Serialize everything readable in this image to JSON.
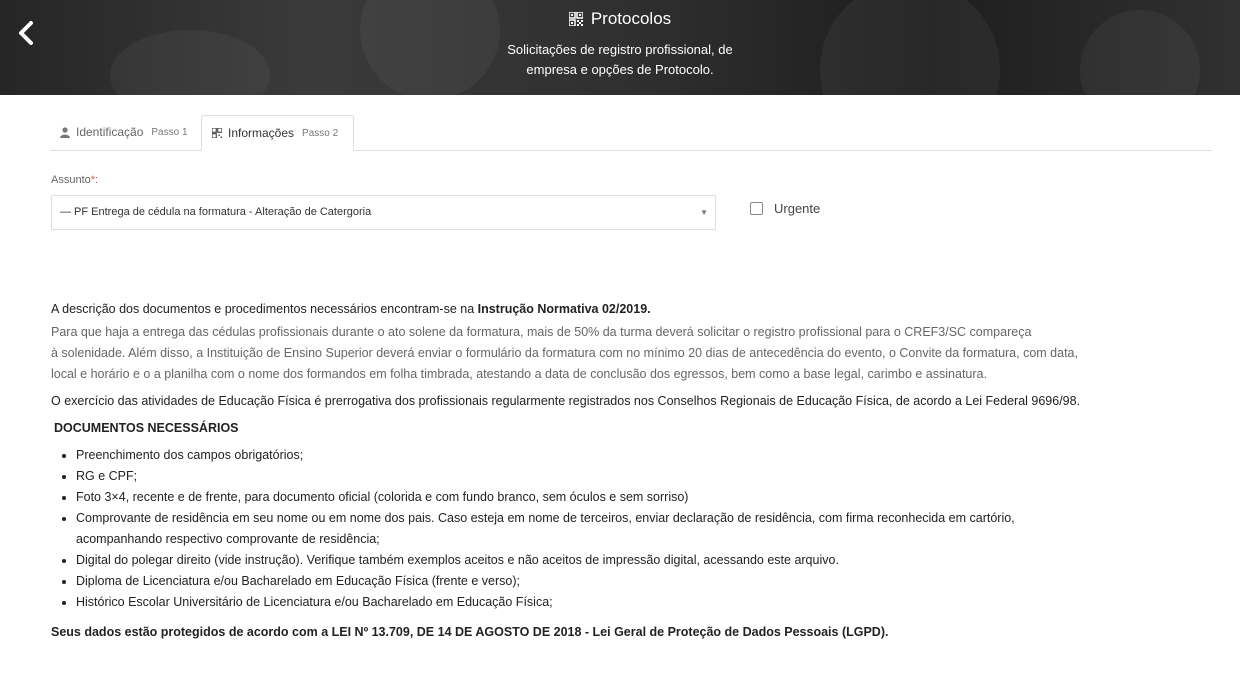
{
  "header": {
    "title": "Protocolos",
    "subtitle_line1": "Solicitações de registro profissional, de",
    "subtitle_line2": "empresa e opções de Protocolo.",
    "back_icon": "chevron-left-icon",
    "title_icon": "qrcode-icon"
  },
  "tabs": [
    {
      "label": "Identificação",
      "step": "Passo 1",
      "icon": "user-icon",
      "active": false
    },
    {
      "label": "Informações",
      "step": "Passo 2",
      "icon": "qrcode-icon",
      "active": true
    }
  ],
  "form": {
    "assunto_label": "Assunto",
    "required_mark": "*:",
    "assunto_value": "— PF Entrega de cédula na formatura - Alteração de Catergoria",
    "caret": "▼",
    "urgent_label": "Urgente",
    "urgent_checked": false
  },
  "content": {
    "p1_prefix": "A descrição dos documentos e procedimentos necessários encontram-se na ",
    "p1_bold": "Instrução Normativa 02/2019.",
    "p2_line1": "Para que haja a entrega das cédulas profissionais durante o ato solene da formatura, mais de 50% da turma deverá solicitar o registro profissional para o CREF3/SC compareça",
    "p2_line2": "à solenidade. Além disso, a Instituição de Ensino Superior deverá enviar o formulário da formatura com no mínimo 20 dias de antecedência do evento, o Convite da formatura, com data,",
    "p2_line3": "local e horário e o a planilha com o nome dos formandos em folha timbrada, atestando a data de conclusão dos egressos, bem como a base legal, carimbo e assinatura.",
    "p3": "O exercício das atividades de Educação Física é prerrogativa dos profissionais regularmente registrados nos Conselhos Regionais de Educação Física, de acordo a Lei Federal 9696/98.",
    "heading": "DOCUMENTOS NECESSÁRIOS",
    "items": [
      "Preenchimento dos campos obrigatórios;",
      "RG e CPF;",
      "Foto 3×4, recente e de frente, para documento oficial (colorida e com fundo branco, sem óculos e sem sorriso)",
      "Comprovante de residência em seu nome ou em nome dos pais. Caso esteja em nome de terceiros, enviar declaração de residência, com firma reconhecida em cartório,",
      "Digital do polegar direito (vide instrução). Verifique também exemplos aceitos e não aceitos de impressão digital, acessando este arquivo.",
      "Diploma de Licenciatura e/ou Bacharelado em Educação Física (frente e verso);",
      "Histórico Escolar Universitário de Licenciatura e/ou Bacharelado em Educação Física;"
    ],
    "item4_line2": "acompanhando respectivo comprovante de residência;",
    "lgpd": "Seus dados estão protegidos de acordo com a LEI Nº 13.709, DE 14 DE AGOSTO DE 2018 - Lei Geral de Proteção de Dados Pessoais (LGPD)."
  }
}
